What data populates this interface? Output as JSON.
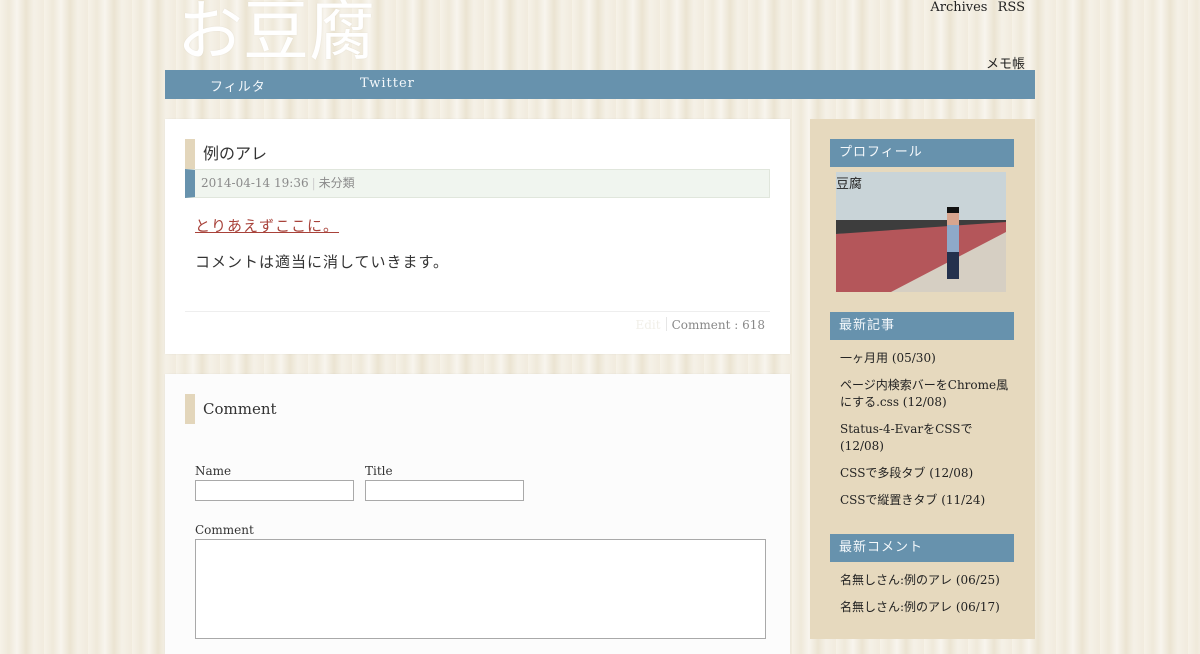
{
  "site": {
    "title": "お豆腐"
  },
  "top_links": [
    "Archives",
    "RSS"
  ],
  "memo": "メモ帳",
  "nav": [
    "フィルタ",
    "Twitter"
  ],
  "post": {
    "title": "例のアレ",
    "date": "2014-04-14 19:36",
    "category": "未分類",
    "link_text": "とりあえずここに。",
    "body": "コメントは適当に消していきます。",
    "edit": "Edit",
    "comment_count": "Comment : 618"
  },
  "comment_form": {
    "heading": "Comment",
    "name_label": "Name",
    "title_label": "Title",
    "comment_label": "Comment"
  },
  "sidebar": {
    "profile": {
      "heading": "プロフィール",
      "name": "豆腐"
    },
    "recent_posts": {
      "heading": "最新記事",
      "items": [
        "一ヶ月用 (05/30)",
        "ページ内検索バーをChrome風にする.css (12/08)",
        "Status-4-EvarをCSSで (12/08)",
        "CSSで多段タブ (12/08)",
        "CSSで縦置きタブ (11/24)"
      ]
    },
    "recent_comments": {
      "heading": "最新コメント",
      "items": [
        "名無しさん:例のアレ (06/25)",
        "名無しさん:例のアレ (06/17)"
      ]
    }
  }
}
